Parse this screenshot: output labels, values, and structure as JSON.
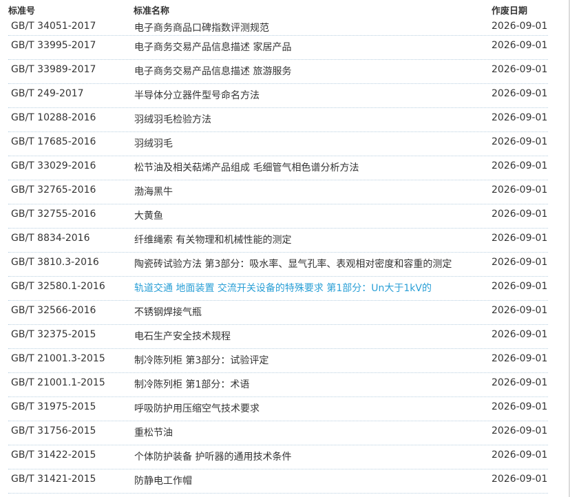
{
  "columns": {
    "code": "标准号",
    "name": "标准名称",
    "date": "作废日期"
  },
  "rows": [
    {
      "code": "GB/T 34051-2017",
      "name": "电子商务商品口碑指数评测规范",
      "date": "2026-09-01"
    },
    {
      "code": "GB/T 33995-2017",
      "name": "电子商务交易产品信息描述 家居产品",
      "date": "2026-09-01"
    },
    {
      "code": "GB/T 33989-2017",
      "name": "电子商务交易产品信息描述 旅游服务",
      "date": "2026-09-01"
    },
    {
      "code": "GB/T 249-2017",
      "name": "半导体分立器件型号命名方法",
      "date": "2026-09-01"
    },
    {
      "code": "GB/T 10288-2016",
      "name": "羽绒羽毛检验方法",
      "date": "2026-09-01"
    },
    {
      "code": "GB/T 17685-2016",
      "name": "羽绒羽毛",
      "date": "2026-09-01"
    },
    {
      "code": "GB/T 33029-2016",
      "name": "松节油及相关萜烯产品组成 毛细管气相色谱分析方法",
      "date": "2026-09-01"
    },
    {
      "code": "GB/T 32765-2016",
      "name": "渤海黑牛",
      "date": "2026-09-01"
    },
    {
      "code": "GB/T 32755-2016",
      "name": "大黄鱼",
      "date": "2026-09-01"
    },
    {
      "code": "GB/T 8834-2016",
      "name": "纤维绳索 有关物理和机械性能的测定",
      "date": "2026-09-01"
    },
    {
      "code": "GB/T 3810.3-2016",
      "name": "陶瓷砖试验方法 第3部分：吸水率、显气孔率、表观相对密度和容重的测定",
      "date": "2026-09-01"
    },
    {
      "code": "GB/T 32580.1-2016",
      "name": "轨道交通 地面装置 交流开关设备的特殊要求 第1部分：Un大于1kV的",
      "date": "2026-09-01",
      "active": true
    },
    {
      "code": "GB/T 32566-2016",
      "name": "不锈钢焊接气瓶",
      "date": "2026-09-01"
    },
    {
      "code": "GB/T 32375-2015",
      "name": "电石生产安全技术规程",
      "date": "2026-09-01"
    },
    {
      "code": "GB/T 21001.3-2015",
      "name": "制冷陈列柜 第3部分：试验评定",
      "date": "2026-09-01"
    },
    {
      "code": "GB/T 21001.1-2015",
      "name": "制冷陈列柜 第1部分：术语",
      "date": "2026-09-01"
    },
    {
      "code": "GB/T 31975-2015",
      "name": "呼吸防护用压缩空气技术要求",
      "date": "2026-09-01"
    },
    {
      "code": "GB/T 31756-2015",
      "name": "重松节油",
      "date": "2026-09-01"
    },
    {
      "code": "GB/T 31422-2015",
      "name": "个体防护装备 护听器的通用技术条件",
      "date": "2026-09-01"
    },
    {
      "code": "GB/T 31421-2015",
      "name": "防静电工作帽",
      "date": "2026-09-01"
    }
  ],
  "colors": {
    "link_active": "#2a9fd6",
    "row_divider": "#b7cfe0"
  }
}
